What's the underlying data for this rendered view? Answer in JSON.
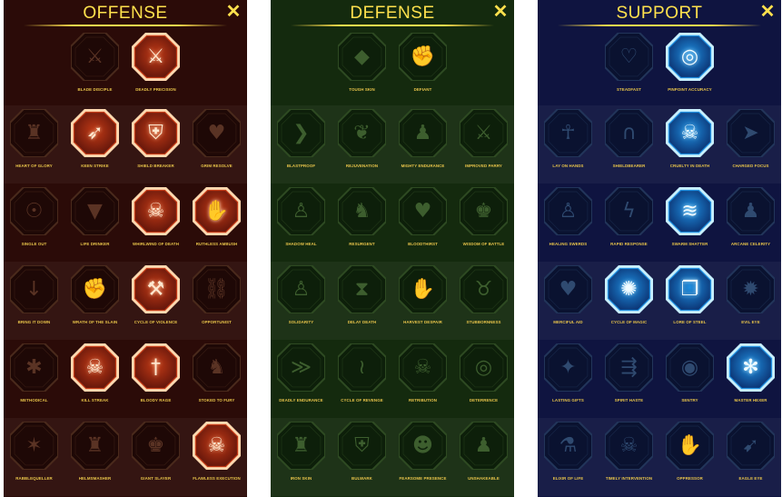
{
  "colors": {
    "title_gold": "#ffe14d",
    "label_gold": "#e8c44a",
    "offense_bg": "#2b0b08",
    "defense_bg": "#142a0e",
    "support_bg": "#0f1440",
    "offense_active": "#ff7a3a",
    "support_active": "#4cc8ff"
  },
  "close_label": "✕",
  "panels": [
    {
      "id": "offense",
      "title": "OFFENSE",
      "rows": [
        [
          {
            "label": "Blade Disciple",
            "icon": "crossed-swords-icon",
            "active": false
          },
          {
            "label": "Deadly Precision",
            "icon": "sword-strike-icon",
            "active": true
          }
        ],
        [
          {
            "label": "Heart of Glory",
            "icon": "horned-warrior-icon",
            "active": false
          },
          {
            "label": "Keen Strike",
            "icon": "piercing-strike-icon",
            "active": true
          },
          {
            "label": "Shield Breaker",
            "icon": "broken-shield-icon",
            "active": true
          },
          {
            "label": "Grim Resolve",
            "icon": "heart-wings-icon",
            "active": false
          }
        ],
        [
          {
            "label": "Single Out",
            "icon": "targeted-warrior-icon",
            "active": false
          },
          {
            "label": "Life Drinker",
            "icon": "fanged-maw-icon",
            "active": false
          },
          {
            "label": "Whirlwind of Death",
            "icon": "skull-whirl-icon",
            "active": true
          },
          {
            "label": "Ruthless Ambush",
            "icon": "dagger-hand-icon",
            "active": true
          }
        ],
        [
          {
            "label": "Bring It Down",
            "icon": "falling-sword-icon",
            "active": false
          },
          {
            "label": "Wrath of the Slain",
            "icon": "fist-icon",
            "active": false
          },
          {
            "label": "Cycle of Violence",
            "icon": "axe-cycle-icon",
            "active": true
          },
          {
            "label": "Opportunist",
            "icon": "chain-icon",
            "active": false
          }
        ],
        [
          {
            "label": "Methodical",
            "icon": "spider-icon",
            "active": false
          },
          {
            "label": "Kill Streak",
            "icon": "skull-trio-icon",
            "active": true
          },
          {
            "label": "Bloody Rage",
            "icon": "blade-icon",
            "active": true
          },
          {
            "label": "Stoked to Fury",
            "icon": "raging-warrior-icon",
            "active": false
          }
        ],
        [
          {
            "label": "Rabblequeller",
            "icon": "sword-cluster-icon",
            "active": false
          },
          {
            "label": "Helmsmasher",
            "icon": "helmet-icon",
            "active": false
          },
          {
            "label": "Giant Slayer",
            "icon": "giant-icon",
            "active": false
          },
          {
            "label": "Flawless Execution",
            "icon": "flaming-skull-icon",
            "active": true
          }
        ]
      ]
    },
    {
      "id": "defense",
      "title": "DEFENSE",
      "rows": [
        [
          {
            "label": "Tough Skin",
            "icon": "scales-icon",
            "active": false
          },
          {
            "label": "Defiant",
            "icon": "raised-fist-icon",
            "active": false
          }
        ],
        [
          {
            "label": "Blastproof",
            "icon": "chevron-shield-icon",
            "active": false
          },
          {
            "label": "Rejuvenation",
            "icon": "heart-leaf-icon",
            "active": false
          },
          {
            "label": "Mighty Endurance",
            "icon": "strongman-icon",
            "active": false
          },
          {
            "label": "Improved Parry",
            "icon": "parry-swords-icon",
            "active": false
          }
        ],
        [
          {
            "label": "Shadow Heal",
            "icon": "shadow-figure-icon",
            "active": false
          },
          {
            "label": "Resurgent",
            "icon": "shielded-knight-icon",
            "active": false
          },
          {
            "label": "Bloodthirst",
            "icon": "blood-heart-icon",
            "active": false
          },
          {
            "label": "Wisdom of Battle",
            "icon": "warrior-bust-icon",
            "active": false
          }
        ],
        [
          {
            "label": "Solidarity",
            "icon": "allies-icon",
            "active": false
          },
          {
            "label": "Delay Death",
            "icon": "hourglass-icon",
            "active": false
          },
          {
            "label": "Harvest Despair",
            "icon": "open-hand-icon",
            "active": false
          },
          {
            "label": "Stubbornness",
            "icon": "bull-icon",
            "active": false
          }
        ],
        [
          {
            "label": "Deadly Endurance",
            "icon": "running-figure-icon",
            "active": false
          },
          {
            "label": "Cycle of Revenge",
            "icon": "claws-icon",
            "active": false
          },
          {
            "label": "Retribution",
            "icon": "skull-burst-icon",
            "active": false
          },
          {
            "label": "Deterrence",
            "icon": "swirl-icon",
            "active": false
          }
        ],
        [
          {
            "label": "Iron Skin",
            "icon": "armored-figure-icon",
            "active": false
          },
          {
            "label": "Bulwark",
            "icon": "shield-wall-icon",
            "active": false
          },
          {
            "label": "Fearsome Presence",
            "icon": "bearded-face-icon",
            "active": false
          },
          {
            "label": "Unshakeable",
            "icon": "stance-icon",
            "active": false
          }
        ]
      ]
    },
    {
      "id": "support",
      "title": "SUPPORT",
      "rows": [
        [
          {
            "label": "Steadfast",
            "icon": "heart-sparkle-icon",
            "active": false
          },
          {
            "label": "Pinpoint Accuracy",
            "icon": "target-strike-icon",
            "active": true
          }
        ],
        [
          {
            "label": "Lay on Hands",
            "icon": "praying-hands-icon",
            "active": false
          },
          {
            "label": "Shieldbearer",
            "icon": "arched-shield-icon",
            "active": false
          },
          {
            "label": "Cruelty in Death",
            "icon": "blue-flame-skull-icon",
            "active": true
          },
          {
            "label": "Charged Focus",
            "icon": "dash-icon",
            "active": false
          }
        ],
        [
          {
            "label": "Healing Swerds",
            "icon": "healer-icon",
            "active": false
          },
          {
            "label": "Rapid Response",
            "icon": "lightning-shield-icon",
            "active": false
          },
          {
            "label": "Swarm Shatter",
            "icon": "shatter-icon",
            "active": true
          },
          {
            "label": "Arcane Celerity",
            "icon": "mage-silhouette-icon",
            "active": false
          }
        ],
        [
          {
            "label": "Merciful Aid",
            "icon": "heart-chain-icon",
            "active": false
          },
          {
            "label": "Cycle of Magic",
            "icon": "magic-orb-icon",
            "active": true
          },
          {
            "label": "Lore of Steel",
            "icon": "open-book-icon",
            "active": true
          },
          {
            "label": "Evil Eye",
            "icon": "evil-eye-icon",
            "active": false
          }
        ],
        [
          {
            "label": "Lasting Gifts",
            "icon": "star-compass-icon",
            "active": false
          },
          {
            "label": "Spirit Haste",
            "icon": "boot-icon",
            "active": false
          },
          {
            "label": "Sentry",
            "icon": "eye-icon",
            "active": false
          },
          {
            "label": "Master Hexer",
            "icon": "hex-figure-icon",
            "active": true
          }
        ],
        [
          {
            "label": "Elixir of Life",
            "icon": "potion-icon",
            "active": false
          },
          {
            "label": "Timely Intervention",
            "icon": "skull-clock-icon",
            "active": false
          },
          {
            "label": "Oppressor",
            "icon": "gauntlet-icon",
            "active": false
          },
          {
            "label": "Eagle Eye",
            "icon": "eagle-icon",
            "active": false
          }
        ]
      ]
    }
  ]
}
